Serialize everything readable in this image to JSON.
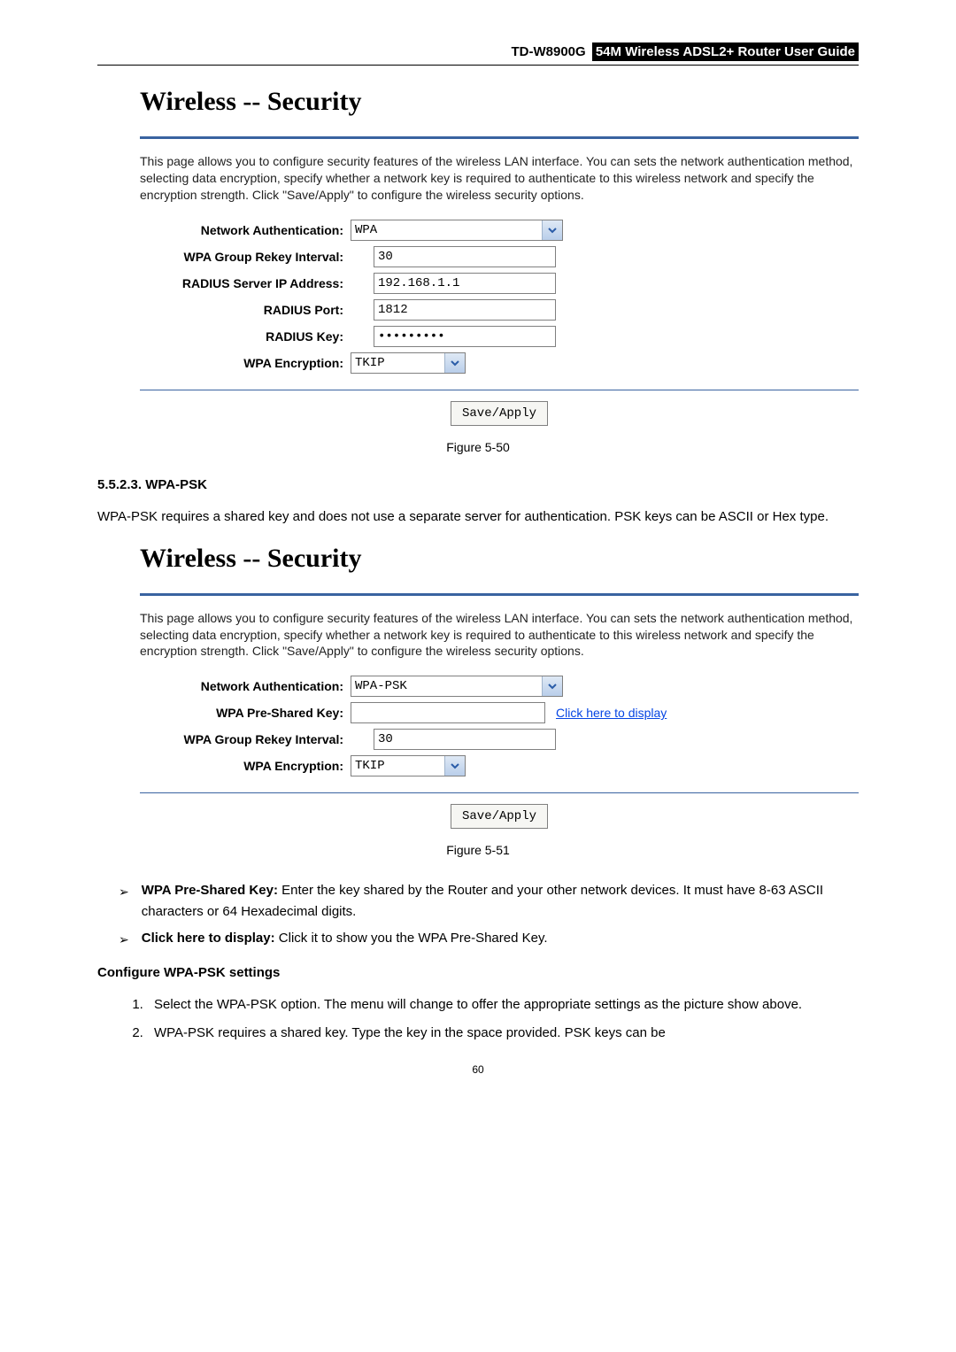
{
  "header": {
    "model": "TD-W8900G",
    "subtitle": "54M Wireless ADSL2+ Router User Guide"
  },
  "figure1": {
    "title": "Wireless -- Security",
    "description": "This page allows you to configure security features of the wireless LAN interface. You can sets the network authentication method, selecting data encryption, specify whether a network key is required to authenticate to this wireless network and specify the encryption strength. Click \"Save/Apply\" to configure the wireless security options.",
    "fields": {
      "network_auth_label": "Network Authentication:",
      "network_auth_value": "WPA",
      "rekey_label": "WPA Group Rekey Interval:",
      "rekey_value": "30",
      "radius_ip_label": "RADIUS Server IP Address:",
      "radius_ip_value": "192.168.1.1",
      "radius_port_label": "RADIUS Port:",
      "radius_port_value": "1812",
      "radius_key_label": "RADIUS Key:",
      "radius_key_value": "•••••••••",
      "wpa_enc_label": "WPA Encryption:",
      "wpa_enc_value": "TKIP"
    },
    "save_btn": "Save/Apply",
    "caption": "Figure 5-50"
  },
  "section_5_5_2_3": {
    "heading": "5.5.2.3. WPA-PSK",
    "intro": "WPA-PSK requires a shared key and does not use a separate server for authentication. PSK keys can be ASCII or Hex type."
  },
  "figure2": {
    "title": "Wireless -- Security",
    "description": "This page allows you to configure security features of the wireless LAN interface. You can sets the network authentication method, selecting data encryption, specify whether a network key is required to authenticate to this wireless network and specify the encryption strength. Click \"Save/Apply\" to configure the wireless security options.",
    "fields": {
      "network_auth_label": "Network Authentication:",
      "network_auth_value": "WPA-PSK",
      "psk_label": "WPA Pre-Shared Key:",
      "psk_value": "",
      "psk_link": "Click here to display",
      "rekey_label": "WPA Group Rekey Interval:",
      "rekey_value": "30",
      "wpa_enc_label": "WPA Encryption:",
      "wpa_enc_value": "TKIP"
    },
    "save_btn": "Save/Apply",
    "caption": "Figure 5-51"
  },
  "bullets": {
    "b1_label": "WPA Pre-Shared Key: ",
    "b1_text": "Enter the key shared by the Router and your other network devices. It must have 8-63 ASCII characters or 64 Hexadecimal digits.",
    "b2_label": "Click here to display: ",
    "b2_text": "Click it to show you the WPA Pre-Shared Key."
  },
  "configure_heading": "Configure WPA-PSK settings",
  "steps": {
    "s1": "Select the WPA-PSK option. The menu will change to offer the appropriate settings as the picture show above.",
    "s2": "WPA-PSK requires a shared key. Type the key in the space provided. PSK keys can be"
  },
  "page_number": "60"
}
